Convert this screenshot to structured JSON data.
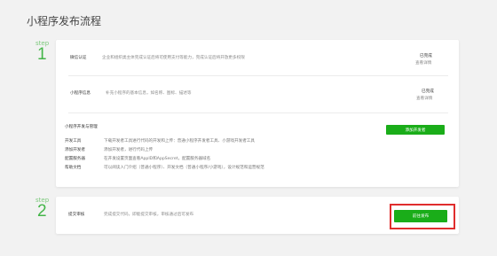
{
  "page": {
    "title": "小程序发布流程"
  },
  "step1": {
    "label": "step",
    "number": "1",
    "rows": [
      {
        "label": "微信认证",
        "desc": "企业和组织类主体完成认证后将可使用支付等能力，完成认证后将开放更多权限",
        "status": "已完成",
        "link": "查看详情"
      },
      {
        "label": "小程序信息",
        "desc": "补充小程序的基本信息，如名称、图标、描述等",
        "status": "已完成",
        "link": "查看详情"
      }
    ],
    "dev": {
      "title": "小程序开发与管理",
      "button": "添加开发者",
      "items": [
        {
          "label": "开发工具",
          "desc": "下载开发者工具进行代码的开发和上传：普通小程序开发者工具、小游戏开发者工具"
        },
        {
          "label": "添加开发者",
          "desc": "添加开发者，进行代码上传"
        },
        {
          "label": "配置服务器",
          "desc": "在开发设置页面查看AppID和AppSecret，配置服务器域名"
        },
        {
          "label": "帮助文档",
          "desc": "可以阅读入门介绍（普通小程序）、开发文档（普通小程序/小游戏），设计规范和运营规范"
        }
      ]
    }
  },
  "step2": {
    "label": "step",
    "number": "2",
    "row": {
      "label": "提交审核",
      "desc": "完成提交代码，即能提交审核，审核通过后可发布",
      "button": "前往发布"
    }
  },
  "colors": {
    "accent": "#1aad19",
    "highlight": "#e02d2d",
    "step_number": "#44b549"
  }
}
